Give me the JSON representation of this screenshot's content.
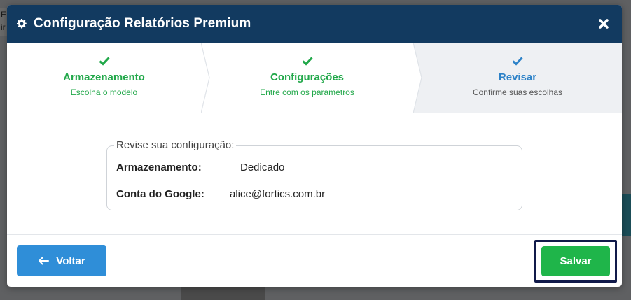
{
  "background": {
    "fragment_text": "E\nir"
  },
  "modal": {
    "title": "Configuração Relatórios Premium",
    "title_icon": "gear-icon",
    "close_icon": "close-icon"
  },
  "steps": [
    {
      "title": "Armazenamento",
      "subtitle": "Escolha o modelo",
      "state": "done",
      "icon": "check-icon",
      "color": "#22a84a"
    },
    {
      "title": "Configurações",
      "subtitle": "Entre com os parametros",
      "state": "done",
      "icon": "check-icon",
      "color": "#22a84a"
    },
    {
      "title": "Revisar",
      "subtitle": "Confirme suas escolhas",
      "state": "active",
      "icon": "check-icon",
      "color": "#2d82c8"
    }
  ],
  "review": {
    "legend": "Revise sua configuração:",
    "rows": [
      {
        "label": "Armazenamento:",
        "value": "Dedicado"
      },
      {
        "label": "Conta do Google:",
        "value": "alice@fortics.com.br"
      }
    ]
  },
  "footer": {
    "back_label": "Voltar",
    "back_icon": "arrow-left-icon",
    "save_label": "Salvar"
  },
  "colors": {
    "header": "#123a60",
    "done": "#22a84a",
    "active": "#2d82c8",
    "back_button": "#2f8ed8",
    "save_button": "#1fb54a"
  }
}
